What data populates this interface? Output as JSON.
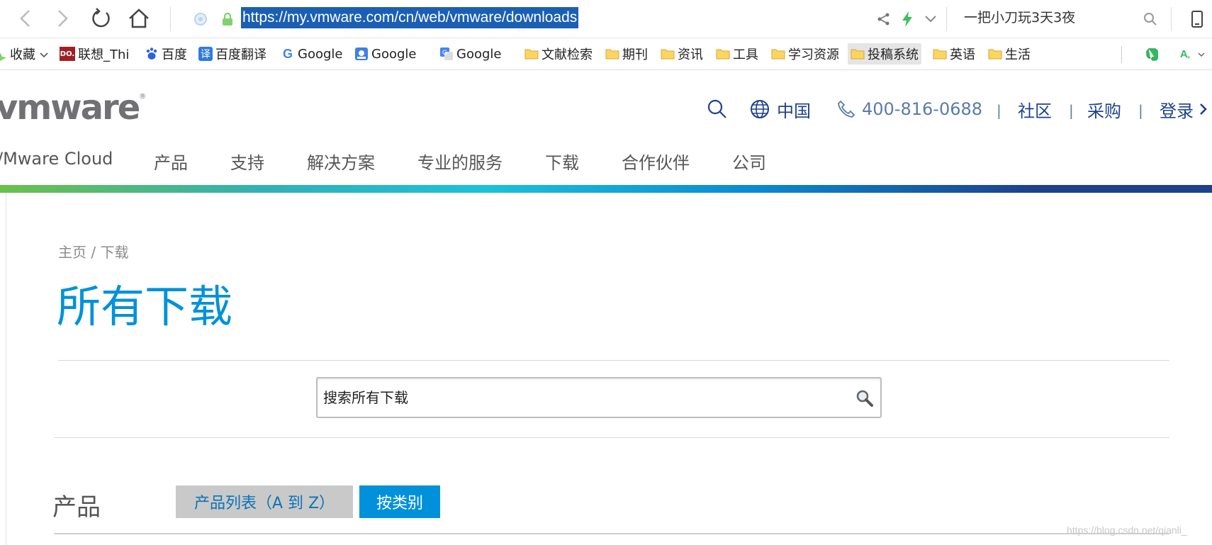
{
  "browser": {
    "url": "https://my.vmware.com/cn/web/vmware/downloads",
    "search_text": "一把小刀玩3天3夜"
  },
  "bookmarks": [
    {
      "label": "收藏",
      "icon": "star-icon"
    },
    {
      "label": "联想_Thi",
      "icon": "lenovo-icon"
    },
    {
      "label": "百度",
      "icon": "baidu-paw-icon"
    },
    {
      "label": "百度翻译",
      "icon": "baidu-translate-icon"
    },
    {
      "label": "Google",
      "icon": "google-g-icon"
    },
    {
      "label": "Google",
      "icon": "google-scholar-icon"
    },
    {
      "label": "Google",
      "icon": "google-translate-icon"
    },
    {
      "label": "文献检索",
      "icon": "folder-icon"
    },
    {
      "label": "期刊",
      "icon": "folder-icon"
    },
    {
      "label": "资讯",
      "icon": "folder-icon"
    },
    {
      "label": "工具",
      "icon": "folder-icon"
    },
    {
      "label": "学习资源",
      "icon": "folder-icon"
    },
    {
      "label": "投稿系统",
      "icon": "folder-icon"
    },
    {
      "label": "英语",
      "icon": "folder-icon"
    },
    {
      "label": "生活",
      "icon": "folder-icon"
    }
  ],
  "header": {
    "logo": "vmware",
    "region": "中国",
    "phone": "400-816-0688",
    "community": "社区",
    "purchase": "采购",
    "login": "登录",
    "separator": "|"
  },
  "nav": [
    "/Mware Cloud",
    "产品",
    "支持",
    "解决方案",
    "专业的服务",
    "下载",
    "合作伙伴",
    "公司"
  ],
  "main": {
    "breadcrumb": "主页 / 下载",
    "title": "所有下载",
    "search_placeholder": "搜索所有下载",
    "products_label": "产品",
    "tabs": [
      {
        "label": "产品列表（A 到 Z）",
        "active": false
      },
      {
        "label": "按类别",
        "active": true
      }
    ]
  },
  "watermark": "https://blog.csdn.net/qianli_",
  "colors": {
    "accent": "#0091da",
    "nav_blue": "#1d428a",
    "url_highlight": "#1a5fb4",
    "tab_inactive": "#c9c9c9"
  }
}
